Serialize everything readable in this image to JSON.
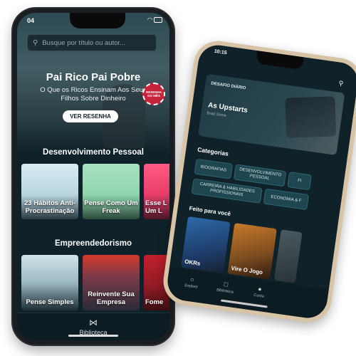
{
  "phone_front": {
    "status_time": "04",
    "search": {
      "placeholder": "Busque por título ou autor..."
    },
    "hero": {
      "title": "Pai Rico Pai Pobre",
      "subtitle": "O Que os Ricos Ensinam Aos Seus Filhos Sobre Dinheiro",
      "badge": "RESENHA DO MÊS",
      "button": "VER RESENHA"
    },
    "sections": [
      {
        "title": "Desenvolvimento  Pessoal",
        "cards": [
          {
            "label": "23 Hábitos Anti-Procrastinação"
          },
          {
            "label": "Pense Como Um Freak"
          },
          {
            "label": "Esse L Um L"
          }
        ]
      },
      {
        "title": "Empreendedorismo",
        "cards": [
          {
            "label": "Pense Simples"
          },
          {
            "label": "Reinvente Sua Empresa"
          },
          {
            "label": "Fome"
          }
        ]
      }
    ],
    "tabbar": {
      "label": "Biblioteca",
      "icon": "bookmark-icon"
    }
  },
  "phone_back": {
    "status_time": "10:15",
    "search_icon": "search-icon",
    "daily_challenge": {
      "label": "DESAFIO DIÁRIO",
      "title": "As Upstarts",
      "author": "Brad Stone"
    },
    "categories_title": "Categorias",
    "categories": [
      {
        "label": "BIOGRAFIAS"
      },
      {
        "label": "DESENVOLVIMENTO PESSOAL"
      },
      {
        "label": "FI"
      },
      {
        "label": "CARREIRA & HABILIDADES PROFISSIONAIS"
      },
      {
        "label": "ECONOMIA & F"
      }
    ],
    "made_for_you_title": "Feito para você",
    "made_for_you": [
      {
        "label": "OKRs"
      },
      {
        "label": "Vire O Jogo"
      }
    ],
    "tabs": [
      {
        "label": "Explore",
        "icon": "compass-icon"
      },
      {
        "label": "Biblioteca",
        "icon": "bookmark-icon"
      },
      {
        "label": "Conta",
        "icon": "user-icon"
      }
    ]
  },
  "colors": {
    "app_background": "#0f2229",
    "chip_background": "#1e4650",
    "badge_red": "#c5233a",
    "phone_gold": "#d7c3a6"
  }
}
